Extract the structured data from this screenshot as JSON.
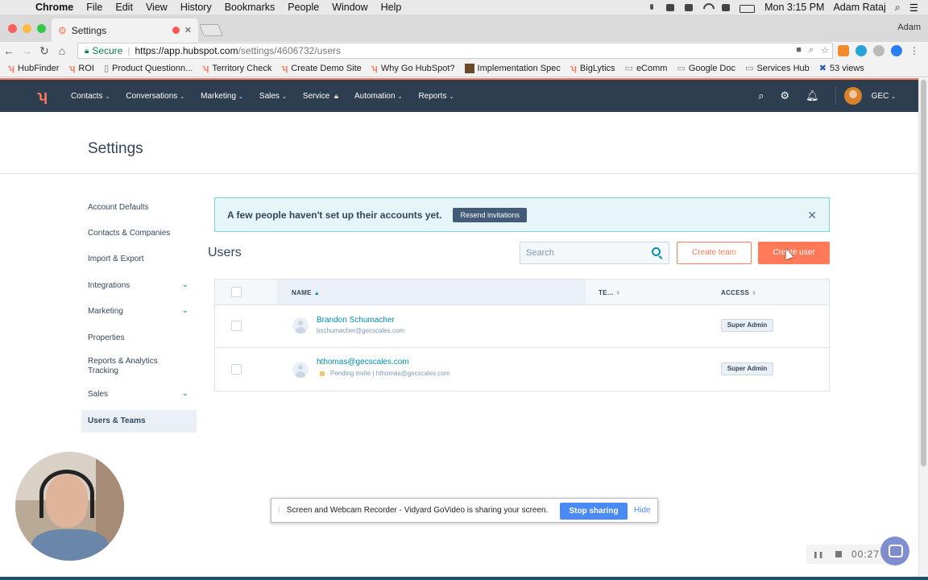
{
  "menubar": {
    "app": "Chrome",
    "items": [
      "File",
      "Edit",
      "View",
      "History",
      "Bookmarks",
      "People",
      "Window",
      "Help"
    ],
    "clock": "Mon 3:15 PM",
    "user": "Adam Rataj"
  },
  "browser": {
    "tab_title": "Settings",
    "profile": "Adam",
    "secure_label": "Secure",
    "url_host": "https://app.hubspot.com",
    "url_path": "/settings/4606732/users"
  },
  "bookmarks": [
    {
      "label": "HubFinder",
      "icon": "hubspot-icon"
    },
    {
      "label": "ROI",
      "icon": "hubspot-icon"
    },
    {
      "label": "Product Questionn...",
      "icon": "page-icon"
    },
    {
      "label": "Territory Check",
      "icon": "hubspot-icon"
    },
    {
      "label": "Create Demo Site",
      "icon": "hubspot-icon"
    },
    {
      "label": "Why Go HubSpot?",
      "icon": "hubspot-icon"
    },
    {
      "label": "Implementation Spec",
      "icon": "image-icon"
    },
    {
      "label": "BigLytics",
      "icon": "hubspot-icon"
    },
    {
      "label": "eComm",
      "icon": "folder-icon"
    },
    {
      "label": "Google Doc",
      "icon": "folder-icon"
    },
    {
      "label": "Services Hub",
      "icon": "folder-icon"
    },
    {
      "label": "53 views",
      "icon": "blue-icon"
    }
  ],
  "hs_nav": {
    "items": [
      {
        "label": "Contacts"
      },
      {
        "label": "Conversations"
      },
      {
        "label": "Marketing"
      },
      {
        "label": "Sales"
      },
      {
        "label": "Service"
      },
      {
        "label": "Automation"
      },
      {
        "label": "Reports"
      }
    ],
    "account": "GEC"
  },
  "page": {
    "title": "Settings"
  },
  "sidebar": {
    "items": [
      {
        "label": "Account Defaults"
      },
      {
        "label": "Contacts & Companies"
      },
      {
        "label": "Import & Export"
      },
      {
        "label": "Integrations"
      },
      {
        "label": "Marketing"
      },
      {
        "label": "Properties"
      },
      {
        "label": "Reports & Analytics Tracking"
      },
      {
        "label": "Sales"
      },
      {
        "label": "Users & Teams"
      }
    ]
  },
  "alert": {
    "message": "A few people haven't set up their accounts yet.",
    "button": "Resend invitations"
  },
  "users": {
    "title": "Users",
    "search_placeholder": "Search",
    "create_team": "Create team",
    "create_user": "Create user",
    "columns": {
      "name": "NAME",
      "team": "TE...",
      "access": "ACCESS"
    },
    "rows": [
      {
        "name": "Brandon Schumacher",
        "email": "bschumacher@gecscales.com",
        "access": "Super Admin"
      },
      {
        "name": "hthomas@gecscales.com",
        "pending": "Pending invite",
        "email": "hthomas@gecscales.com",
        "access": "Super Admin"
      }
    ]
  },
  "share_bar": {
    "message": "Screen and Webcam Recorder - Vidyard GoVideo is sharing your screen.",
    "stop": "Stop sharing",
    "hide": "Hide"
  },
  "recorder": {
    "timer": "00:27"
  },
  "colors": {
    "hubspot_orange": "#ff7a59",
    "nav_bg": "#2d3e50",
    "link": "#0091ae"
  }
}
